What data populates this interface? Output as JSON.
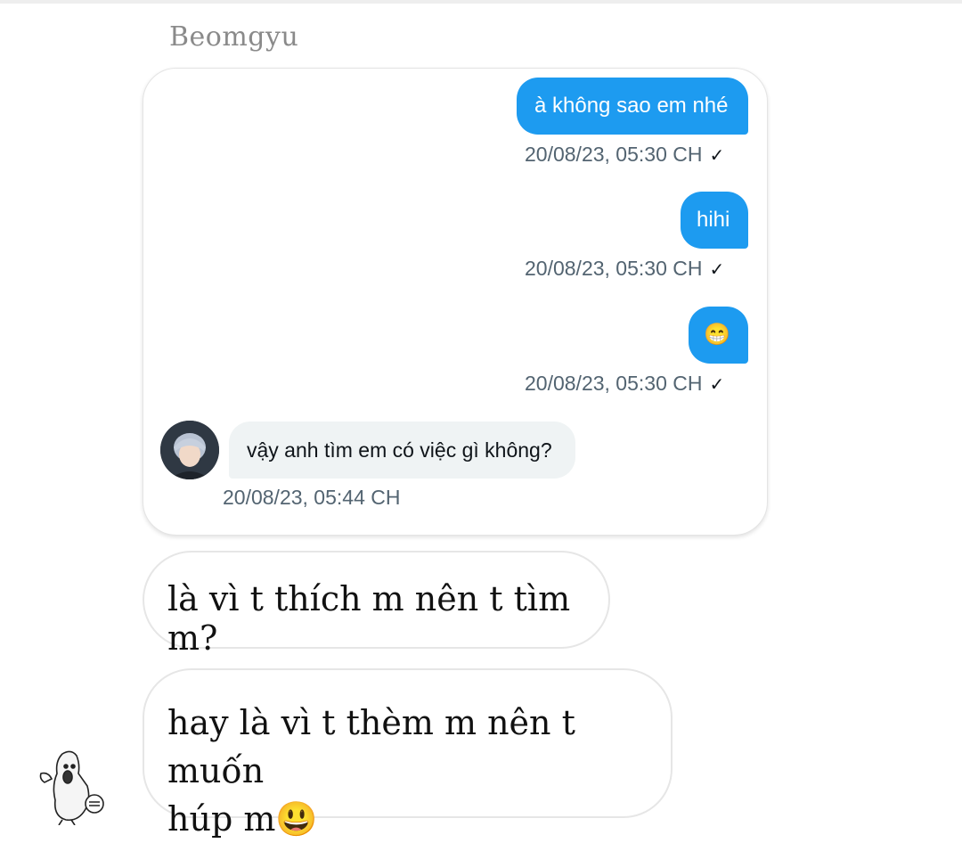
{
  "sender_name": "Beomgyu",
  "chat": {
    "outgoing": [
      {
        "text": "à không sao em nhé",
        "time": "20/08/23, 05:30 CH",
        "status": "✓"
      },
      {
        "text": "hihi",
        "time": "20/08/23, 05:30 CH",
        "status": "✓"
      },
      {
        "text": "😁",
        "time": "20/08/23, 05:30 CH",
        "status": "✓"
      }
    ],
    "incoming": {
      "text": "vậy anh tìm em có việc gì không?",
      "time": "20/08/23, 05:44 CH"
    }
  },
  "caption": {
    "line1": "là vì t thích m nên t tìm m?",
    "line2a": "hay là vì t thèm m nên t muốn",
    "line2b": "húp m😃"
  },
  "colors": {
    "outgoing_bubble": "#1d9bf0",
    "incoming_bubble": "#eff3f4",
    "timestamp": "#536471"
  },
  "icons": {
    "check": "check-icon",
    "sticker": "meme-sticker-icon",
    "avatar": "avatar"
  }
}
